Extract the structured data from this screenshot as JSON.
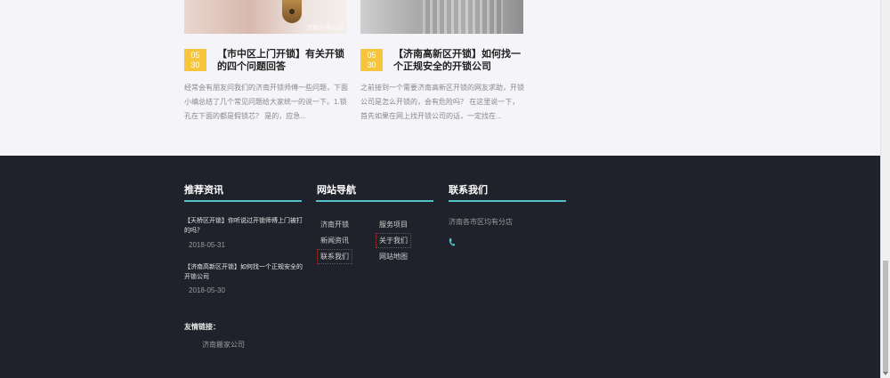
{
  "articles": [
    {
      "date_day": "05",
      "date_month": "30",
      "title": "【市中区上门开锁】有关开锁的四个问题回答",
      "excerpt": "经常会有朋友问我们的济南开锁师傅一些问题，下面小编总结了几个常见问题给大家统一的说一下。1.锁孔在下面的都是假锁芯？ 是的，应急...",
      "image_watermark": "济南开锁公司"
    },
    {
      "date_day": "05",
      "date_month": "30",
      "title": "【济南高新区开锁】如何找一个正规安全的开锁公司",
      "excerpt": "之前接到一个需要济南高新区开锁的网友求助，开锁公司是怎么开锁的，会有危险吗？ 在这里说一下，首先如果在网上找开锁公司的话，一定找在..."
    }
  ],
  "footer": {
    "recommended": {
      "heading": "推荐资讯",
      "items": [
        {
          "title": "【天桥区开锁】你听说过开锁师傅上门被打的吗？",
          "date": "2018-05-31"
        },
        {
          "title": "【济南高新区开锁】如何找一个正规安全的开锁公司",
          "date": "2018-05-30"
        }
      ]
    },
    "nav": {
      "heading": "网站导航",
      "links": [
        "济南开锁",
        "服务项目",
        "新闻资讯",
        "关于我们",
        "联系我们",
        "网站地图"
      ]
    },
    "contact": {
      "heading": "联系我们",
      "address": "济南各市区均有分店",
      "phone_icon": "phone-icon"
    },
    "friend_links": {
      "label": "友情链接：",
      "items": [
        "济南搬家公司"
      ]
    }
  },
  "colors": {
    "accent_line": "#4fc3c9",
    "date_badge": "#f6c53b",
    "footer_bg": "#20222b"
  }
}
